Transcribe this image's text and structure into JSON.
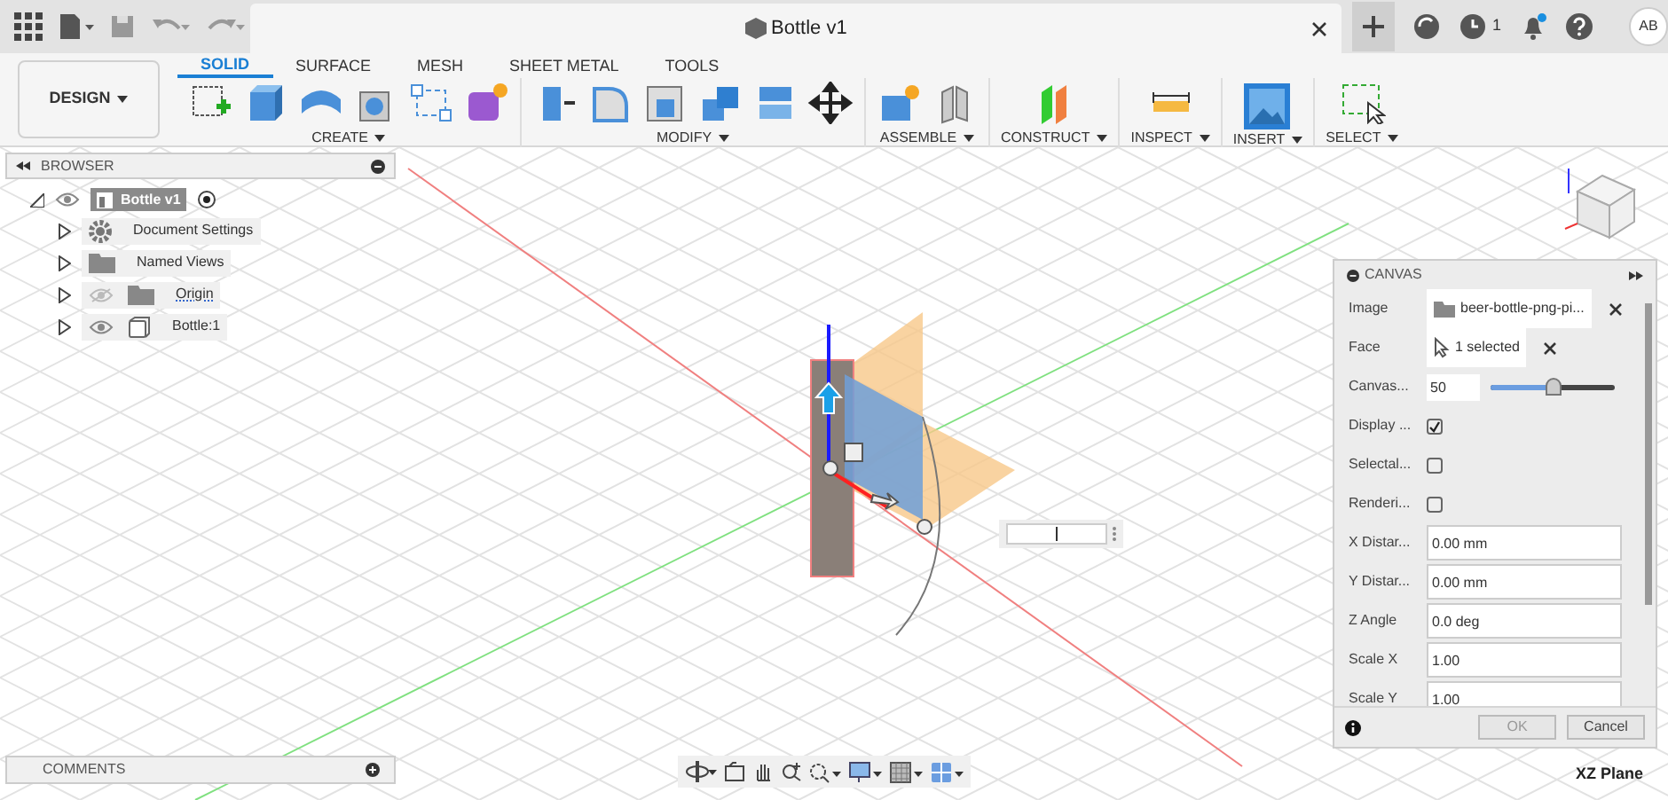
{
  "title_bar": {
    "document_title": "Bottle v1",
    "job_count": "1",
    "user_initials": "AB"
  },
  "toolbar": {
    "workspace": "DESIGN",
    "tabs": [
      {
        "label": "SOLID",
        "selected": true
      },
      {
        "label": "SURFACE",
        "selected": false
      },
      {
        "label": "MESH",
        "selected": false
      },
      {
        "label": "SHEET METAL",
        "selected": false
      },
      {
        "label": "TOOLS",
        "selected": false
      }
    ],
    "groups": [
      {
        "label": "CREATE"
      },
      {
        "label": "MODIFY"
      },
      {
        "label": "ASSEMBLE"
      },
      {
        "label": "CONSTRUCT"
      },
      {
        "label": "INSPECT"
      },
      {
        "label": "INSERT"
      },
      {
        "label": "SELECT"
      }
    ]
  },
  "browser": {
    "title": "BROWSER",
    "root": {
      "label": "Bottle v1",
      "selected": true,
      "children": [
        {
          "label": "Document Settings",
          "kind": "settings",
          "selected": false
        },
        {
          "label": "Named Views",
          "kind": "folder",
          "selected": false
        },
        {
          "label": "Origin",
          "kind": "folder",
          "visible": false,
          "selected": false
        },
        {
          "label": "Bottle:1",
          "kind": "body",
          "visible": true,
          "selected": false
        }
      ]
    }
  },
  "canvas_dialog": {
    "title": "CANVAS",
    "rows": [
      {
        "kind": "selection",
        "label": "Image",
        "value": "beer-bottle-png-pi..."
      },
      {
        "kind": "selection",
        "label": "Face",
        "value": "1 selected"
      },
      {
        "kind": "slider",
        "label": "Canvas...",
        "value": "50",
        "level": 0.5
      },
      {
        "kind": "checkbox",
        "label": "Display ...",
        "checked": true
      },
      {
        "kind": "checkbox",
        "label": "Selectal...",
        "checked": false
      },
      {
        "kind": "checkbox",
        "label": "Renderi...",
        "checked": false
      },
      {
        "kind": "input",
        "label": "X Distar...",
        "value": "0.00 mm"
      },
      {
        "kind": "input",
        "label": "Y Distar...",
        "value": "0.00 mm"
      },
      {
        "kind": "input",
        "label": "Z Angle",
        "value": "0.0 deg"
      },
      {
        "kind": "input",
        "label": "Scale X",
        "value": "1.00"
      },
      {
        "kind": "input",
        "label": "Scale Y",
        "value": "1.00"
      }
    ],
    "buttons": [
      {
        "label": "OK",
        "disabled": true
      },
      {
        "label": "Cancel",
        "disabled": false
      }
    ]
  },
  "comments": {
    "title": "COMMENTS"
  },
  "status": {
    "plane": "XZ Plane"
  }
}
